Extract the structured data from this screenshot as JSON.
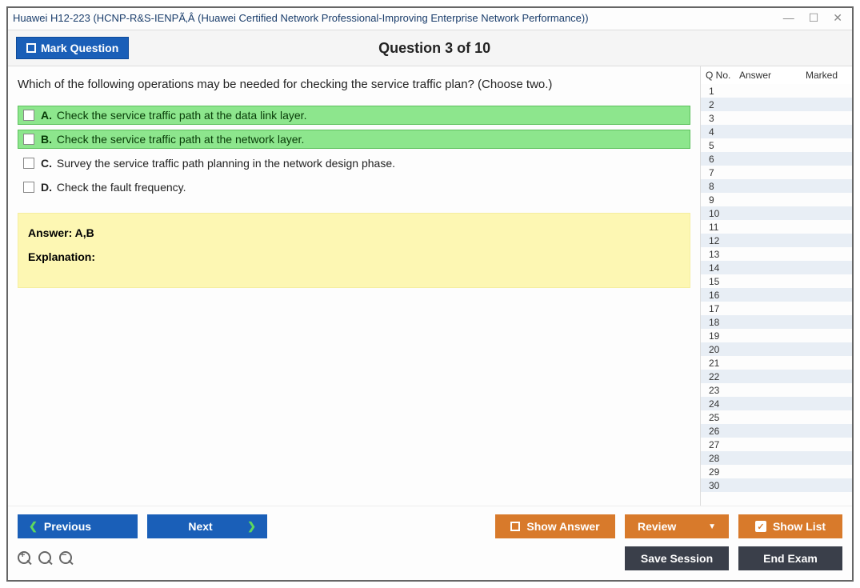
{
  "window": {
    "title": "Huawei H12-223 (HCNP-R&S-IENPÃ‚Â (Huawei Certified Network Professional-Improving Enterprise Network Performance))"
  },
  "header": {
    "mark_label": "Mark Question",
    "indicator": "Question 3 of 10"
  },
  "question": {
    "text": "Which of the following operations may be needed for checking the service traffic plan? (Choose two.)",
    "options": [
      {
        "letter": "A.",
        "text": "Check the service traffic path at the data link layer.",
        "correct": true
      },
      {
        "letter": "B.",
        "text": "Check the service traffic path at the network layer.",
        "correct": true
      },
      {
        "letter": "C.",
        "text": "Survey the service traffic path planning in the network design phase.",
        "correct": false
      },
      {
        "letter": "D.",
        "text": "Check the fault frequency.",
        "correct": false
      }
    ],
    "answer_line": "Answer: A,B",
    "explanation_label": "Explanation:"
  },
  "sidebar": {
    "headers": {
      "c1": "Q No.",
      "c2": "Answer",
      "c3": "Marked"
    },
    "rows": 30
  },
  "footer": {
    "previous": "Previous",
    "next": "Next",
    "show_answer": "Show Answer",
    "review": "Review",
    "show_list": "Show List",
    "save_session": "Save Session",
    "end_exam": "End Exam"
  }
}
